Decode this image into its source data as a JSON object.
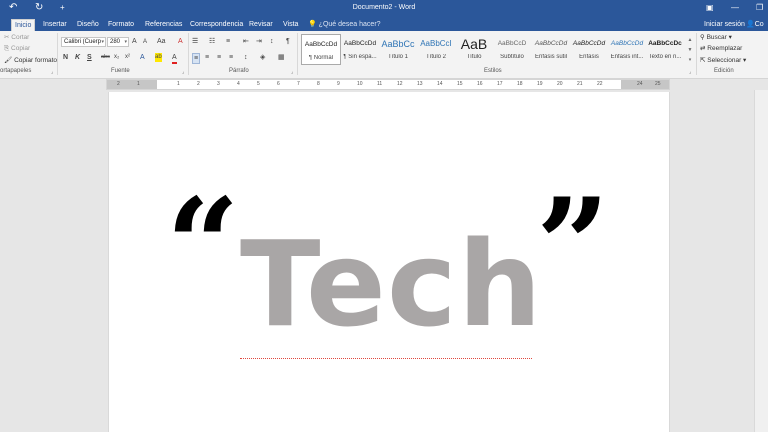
{
  "window": {
    "title": "Documento2 - Word",
    "quick_access": {
      "undo_icon": "↶",
      "redo_icon": "↻",
      "customize_icon": "+"
    },
    "controls": {
      "ribbon_display": "▣",
      "minimize": "—",
      "restore": "❐"
    }
  },
  "tabs": [
    {
      "label": "Inicio",
      "active": true
    },
    {
      "label": "Insertar"
    },
    {
      "label": "Diseño"
    },
    {
      "label": "Formato"
    },
    {
      "label": "Referencias"
    },
    {
      "label": "Correspondencia"
    },
    {
      "label": "Revisar"
    },
    {
      "label": "Vista"
    }
  ],
  "tell_me": {
    "icon": "💡",
    "placeholder": "¿Qué desea hacer?"
  },
  "account": {
    "signin": "Iniciar sesión",
    "share_icon": "👤",
    "share": "Co"
  },
  "clipboard": {
    "cut": "Cortar",
    "copy": "Copiar",
    "format_painter": "Copiar formato",
    "group_label": "ortapapeles"
  },
  "font": {
    "name": "Calibri (Cuerp",
    "size": "280",
    "group_label": "Fuente",
    "grow_icon": "A",
    "shrink_icon": "A",
    "case_icon": "Aa",
    "clear_icon": "A",
    "bold": "N",
    "italic": "K",
    "underline": "S",
    "strike": "abc",
    "subscript": "x₂",
    "superscript": "x²",
    "effects_icon": "A",
    "highlight_icon": "ab",
    "color_icon": "A"
  },
  "paragraph": {
    "group_label": "Párrafo",
    "bullets_icon": "☰",
    "numbering_icon": "☷",
    "multilevel_icon": "≡",
    "decrease_indent_icon": "⇤",
    "increase_indent_icon": "⇥",
    "sort_icon": "↕",
    "pilcrow_icon": "¶",
    "align_left_icon": "≡",
    "center_icon": "≡",
    "align_right_icon": "≡",
    "justify_icon": "≡",
    "line_spacing_icon": "↕",
    "shading_icon": "◈",
    "borders_icon": "▦"
  },
  "styles": {
    "group_label": "Estilos",
    "items": [
      {
        "preview": "AaBbCcDd",
        "name": "¶ Normal",
        "active": true
      },
      {
        "preview": "AaBbCcDd",
        "name": "¶ Sin espa..."
      },
      {
        "preview": "AaBbCc",
        "name": "Título 1"
      },
      {
        "preview": "AaBbCcI",
        "name": "Título 2"
      },
      {
        "preview": "AaB",
        "name": "Título"
      },
      {
        "preview": "AaBbCcD",
        "name": "Subtítulo"
      },
      {
        "preview": "AaBbCcDd",
        "name": "Énfasis sutil"
      },
      {
        "preview": "AaBbCcDd",
        "name": "Énfasis"
      },
      {
        "preview": "AaBbCcDd",
        "name": "Énfasis int..."
      },
      {
        "preview": "AaBbCcDc",
        "name": "Texto en n..."
      }
    ]
  },
  "editing": {
    "group_label": "Edición",
    "find": "Buscar",
    "replace": "Reemplazar",
    "select": "Seleccionar"
  },
  "ruler": [
    "2",
    "1",
    "1",
    "2",
    "3",
    "4",
    "5",
    "6",
    "7",
    "8",
    "9",
    "10",
    "11",
    "12",
    "13",
    "14",
    "15",
    "16",
    "17",
    "18",
    "19",
    "20",
    "21",
    "22",
    "24",
    "25"
  ],
  "document": {
    "open_quote": "“",
    "word": "Tech",
    "close_quote": "”"
  }
}
